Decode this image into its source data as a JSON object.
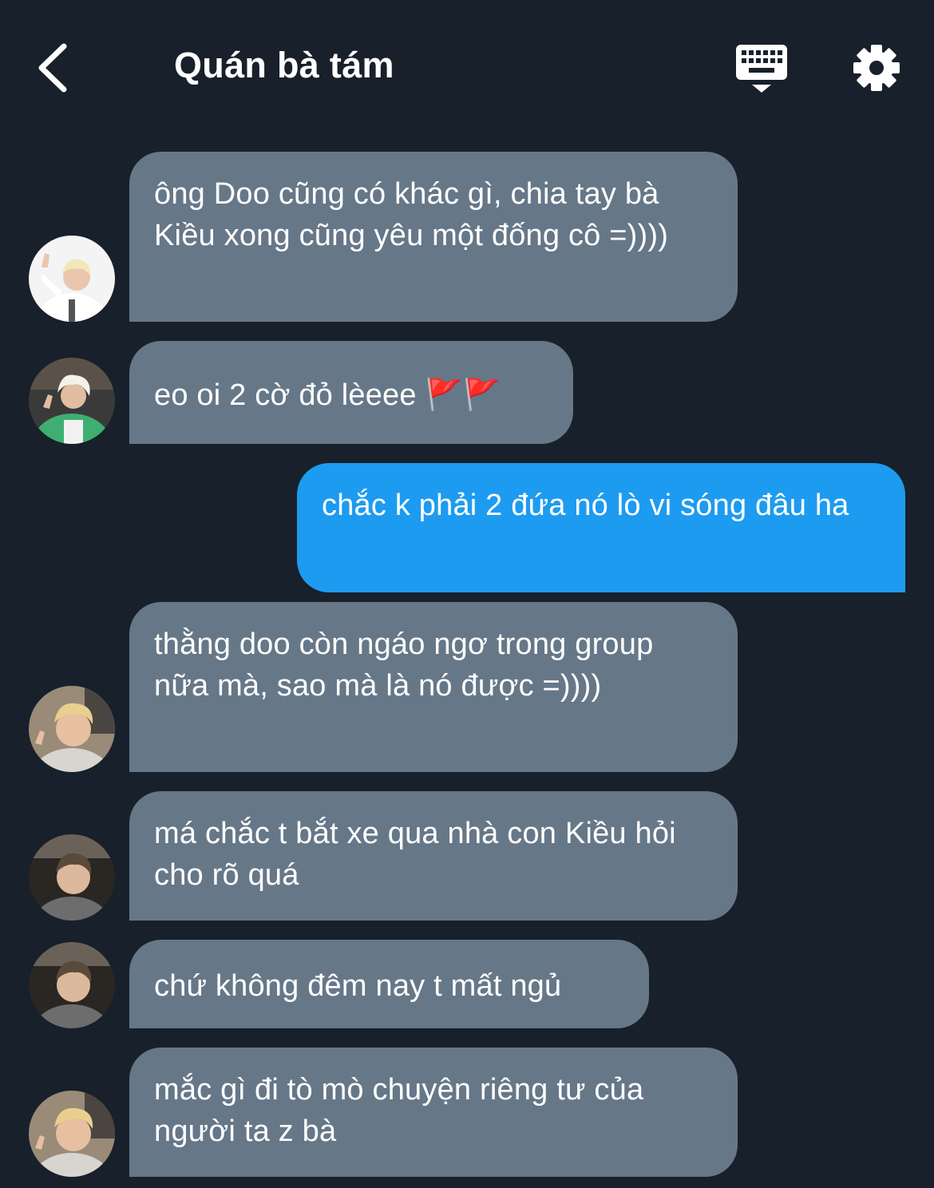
{
  "header": {
    "title": "Quán bà tám",
    "back_icon": "chevron-left-icon",
    "keyboard_icon": "keyboard-icon",
    "settings_icon": "gear-icon"
  },
  "colors": {
    "background": "#17202b",
    "received_bubble": "#667788",
    "sent_bubble": "#1d9bf0",
    "text": "#ffffff"
  },
  "messages": [
    {
      "sender": "other",
      "avatar": "avatar-1",
      "text": "ông Doo cũng có khác gì, chia tay bà Kiều xong cũng yêu một đống cô =))))"
    },
    {
      "sender": "other",
      "avatar": "avatar-2",
      "text": "eo oi 2 cờ đỏ lèeee 🚩🚩"
    },
    {
      "sender": "me",
      "text": "chắc k phải 2 đứa nó lò vi sóng đâu ha"
    },
    {
      "sender": "other",
      "avatar": "avatar-3",
      "text": "thằng doo còn ngáo ngơ trong group nữa mà, sao mà là nó được =))))"
    },
    {
      "sender": "other",
      "avatar": "avatar-4",
      "text": "má chắc t bắt xe qua nhà con Kiều hỏi cho rõ quá"
    },
    {
      "sender": "other",
      "avatar": "avatar-4",
      "text": "chứ không đêm nay t mất ngủ"
    },
    {
      "sender": "other",
      "avatar": "avatar-3",
      "text": "mắc gì đi tò mò chuyện riêng tư của người ta z bà"
    }
  ]
}
